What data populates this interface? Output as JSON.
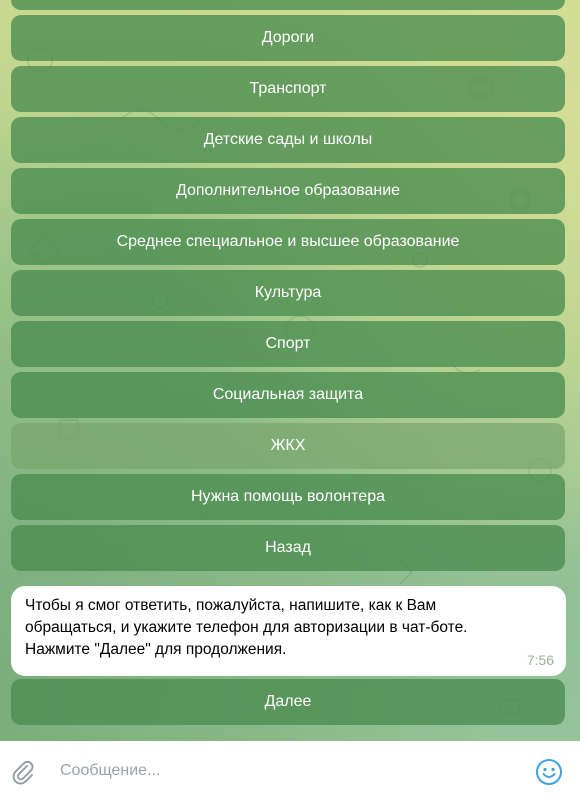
{
  "keyboard": {
    "buttons": [
      "Дороги",
      "Транспорт",
      "Детские сады и школы",
      "Дополнительное образование",
      "Среднее специальное и высшее образование",
      "Культура",
      "Спорт",
      "Социальная защита",
      "ЖКХ",
      "Нужна помощь волонтера",
      "Назад"
    ],
    "next_label": "Далее"
  },
  "message": {
    "text": "Чтобы я смог ответить, пожалуйста, напишите, как к Вам\nобращаться, и укажите телефон для авторизации в чат-боте.\nНажмите \"Далее\" для продолжения.",
    "time": "7:56"
  },
  "composer": {
    "placeholder": "Сообщение...",
    "attach_icon": "paperclip-icon",
    "emoji_icon": "smiley-icon"
  },
  "colors": {
    "button_bg": "#4a8c50",
    "accent": "#3ea3e0"
  }
}
